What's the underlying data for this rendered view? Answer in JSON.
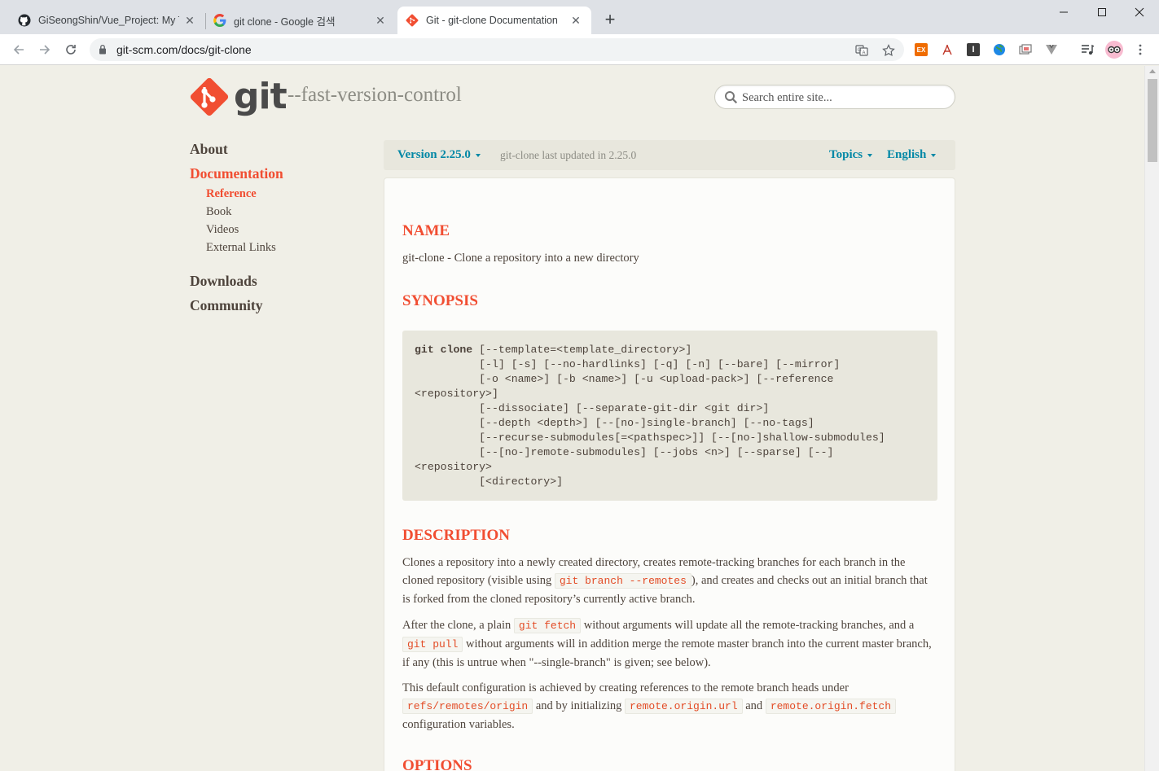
{
  "browser": {
    "tabs": [
      {
        "title": "GiSeongShin/Vue_Project: My To",
        "favicon": "github-icon",
        "active": false
      },
      {
        "title": "git clone - Google 검색",
        "favicon": "google-icon",
        "active": false
      },
      {
        "title": "Git - git-clone Documentation",
        "favicon": "git-icon",
        "active": true
      }
    ],
    "url": "git-scm.com/docs/git-clone"
  },
  "site": {
    "wordmark": "git",
    "tagline": "--fast-version-control",
    "search_placeholder": "Search entire site..."
  },
  "sidebar": {
    "sections": [
      {
        "label": "About",
        "active": false
      },
      {
        "label": "Documentation",
        "active": true
      },
      {
        "label": "Downloads",
        "active": false
      },
      {
        "label": "Community",
        "active": false
      }
    ],
    "doc_items": [
      {
        "label": "Reference",
        "active": true
      },
      {
        "label": "Book",
        "active": false
      },
      {
        "label": "Videos",
        "active": false
      },
      {
        "label": "External Links",
        "active": false
      }
    ]
  },
  "version_bar": {
    "version": "Version 2.25.0",
    "updated": "git-clone last updated in 2.25.0",
    "topics": "Topics",
    "language": "English"
  },
  "doc": {
    "name_heading": "NAME",
    "name_text": "git-clone - Clone a repository into a new directory",
    "synopsis_heading": "SYNOPSIS",
    "synopsis_cmd": "git clone",
    "synopsis_rest": " [--template=<template_directory>]\n          [-l] [-s] [--no-hardlinks] [-q] [-n] [--bare] [--mirror]\n          [-o <name>] [-b <name>] [-u <upload-pack>] [--reference\n<repository>]\n          [--dissociate] [--separate-git-dir <git dir>]\n          [--depth <depth>] [--[no-]single-branch] [--no-tags]\n          [--recurse-submodules[=<pathspec>]] [--[no-]shallow-submodules]\n          [--[no-]remote-submodules] [--jobs <n>] [--sparse] [--]\n<repository>\n          [<directory>]",
    "description_heading": "DESCRIPTION",
    "p1": {
      "a": "Clones a repository into a newly created directory, creates remote-tracking branches for each branch in the cloned repository (visible using ",
      "code1": "git branch --remotes",
      "b": "), and creates and checks out an initial branch that is forked from the cloned repository’s currently active branch."
    },
    "p2": {
      "a": "After the clone, a plain ",
      "code1": "git fetch",
      "b": " without arguments will update all the remote-tracking branches, and a ",
      "code2": "git pull",
      "c": " without arguments will in addition merge the remote master branch into the current master branch, if any (this is untrue when \"--single-branch\" is given; see below)."
    },
    "p3": {
      "a": "This default configuration is achieved by creating references to the remote branch heads under ",
      "code1": "refs/remotes/origin",
      "b": " and by initializing ",
      "code2": "remote.origin.url",
      "c": " and ",
      "code3": "remote.origin.fetch",
      "d": " configuration variables."
    },
    "options_heading": "OPTIONS"
  },
  "colors": {
    "accent": "#f14e32",
    "link": "#0388a6",
    "text": "#4e443c",
    "page_bg": "#f0efe7"
  }
}
